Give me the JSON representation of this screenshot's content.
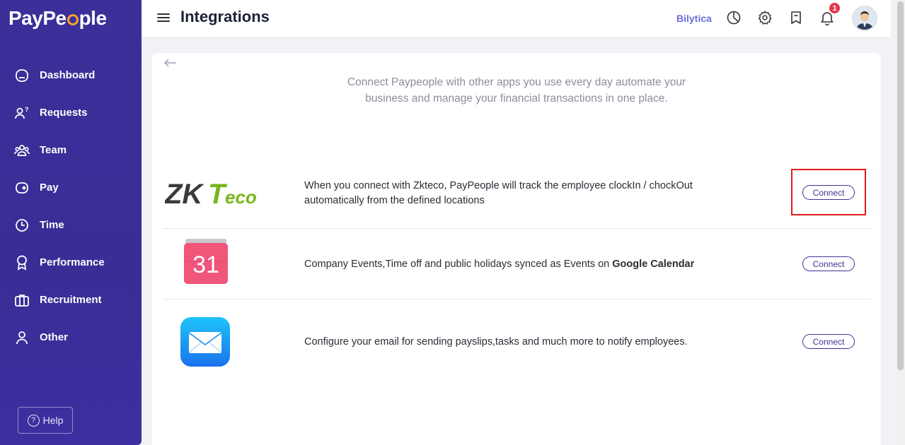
{
  "app": {
    "logo_text_left": "PayPe",
    "logo_text_right": "ple",
    "company_name": "Bilytica",
    "notifications_count": "1"
  },
  "header": {
    "title": "Integrations"
  },
  "sidebar": {
    "items": [
      {
        "label": "Dashboard",
        "icon": "dashboard-icon"
      },
      {
        "label": "Requests",
        "icon": "requests-icon"
      },
      {
        "label": "Team",
        "icon": "team-icon"
      },
      {
        "label": "Pay",
        "icon": "pay-icon"
      },
      {
        "label": "Time",
        "icon": "clock-icon"
      },
      {
        "label": "Performance",
        "icon": "award-icon"
      },
      {
        "label": "Recruitment",
        "icon": "briefcase-icon"
      },
      {
        "label": "Other",
        "icon": "user-icon"
      }
    ],
    "help_label": "Help"
  },
  "main": {
    "intro": "Connect Paypeople with other apps you use every day automate your business and manage your financial transactions in one place.",
    "integrations": [
      {
        "name": "ZKTeco",
        "logo_zk": "ZK",
        "logo_t": "T",
        "logo_eco": "eco",
        "description": "When you connect with Zkteco, PayPeople will track the employee clockIn / chockOut automatically from the defined locations",
        "button": "Connect"
      },
      {
        "name": "Google Calendar",
        "calendar_day": "31",
        "description_prefix": "Company Events,Time off and public holidays synced as Events on ",
        "description_bold": "Google Calendar",
        "button": "Connect"
      },
      {
        "name": "Email",
        "description": "Configure your email for sending payslips,tasks and much more to notify employees.",
        "button": "Connect"
      }
    ]
  },
  "colors": {
    "sidebar": "#3b2f9a",
    "accent": "#3d3494",
    "highlight": "#e11b1b",
    "zk_gray": "#3a3a3a",
    "zk_green": "#7ab51d",
    "calendar_pink": "#f0557a",
    "mail_blue": "#1a8ff0"
  }
}
